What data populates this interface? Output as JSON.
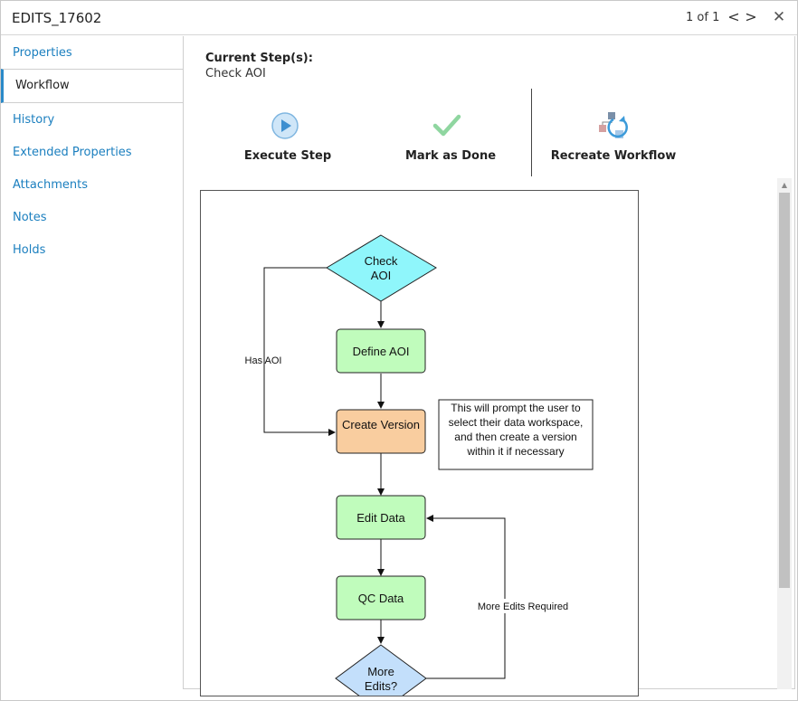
{
  "window": {
    "title": "EDITS_17602",
    "pager": "1 of 1",
    "prev_glyph": "<",
    "next_glyph": ">",
    "close_glyph": "✕"
  },
  "sidebar": {
    "items": [
      {
        "label": "Properties",
        "active": false
      },
      {
        "label": "Workflow",
        "active": true
      },
      {
        "label": "History",
        "active": false
      },
      {
        "label": "Extended Properties",
        "active": false
      },
      {
        "label": "Attachments",
        "active": false
      },
      {
        "label": "Notes",
        "active": false
      },
      {
        "label": "Holds",
        "active": false
      }
    ]
  },
  "workflow": {
    "current_step_label": "Current Step(s):",
    "current_step_value": "Check AOI",
    "actions": {
      "execute": "Execute Step",
      "mark_done": "Mark as Done",
      "recreate": "Recreate Workflow"
    }
  },
  "diagram": {
    "check_aoi_1": "Check",
    "check_aoi_2": "AOI",
    "define_aoi": "Define AOI",
    "create_version": "Create Version",
    "edit_data": "Edit Data",
    "qc_data": "QC Data",
    "more_edits_1": "More",
    "more_edits_2": "Edits?",
    "has_aoi": "Has AOI",
    "more_edits_required": "More Edits Required",
    "note_lines": [
      "This will prompt the user to",
      "select their data workspace,",
      "and then create a version",
      "within it if necessary"
    ]
  },
  "colors": {
    "link": "#1b7fbf",
    "accent": "#2a8ac9",
    "decision_cyan": "#8ff6fb",
    "step_green": "#c0fcbc",
    "step_orange": "#f9cd9f",
    "decision_blue": "#c3dffb",
    "check_green": "#8fd6a0"
  }
}
